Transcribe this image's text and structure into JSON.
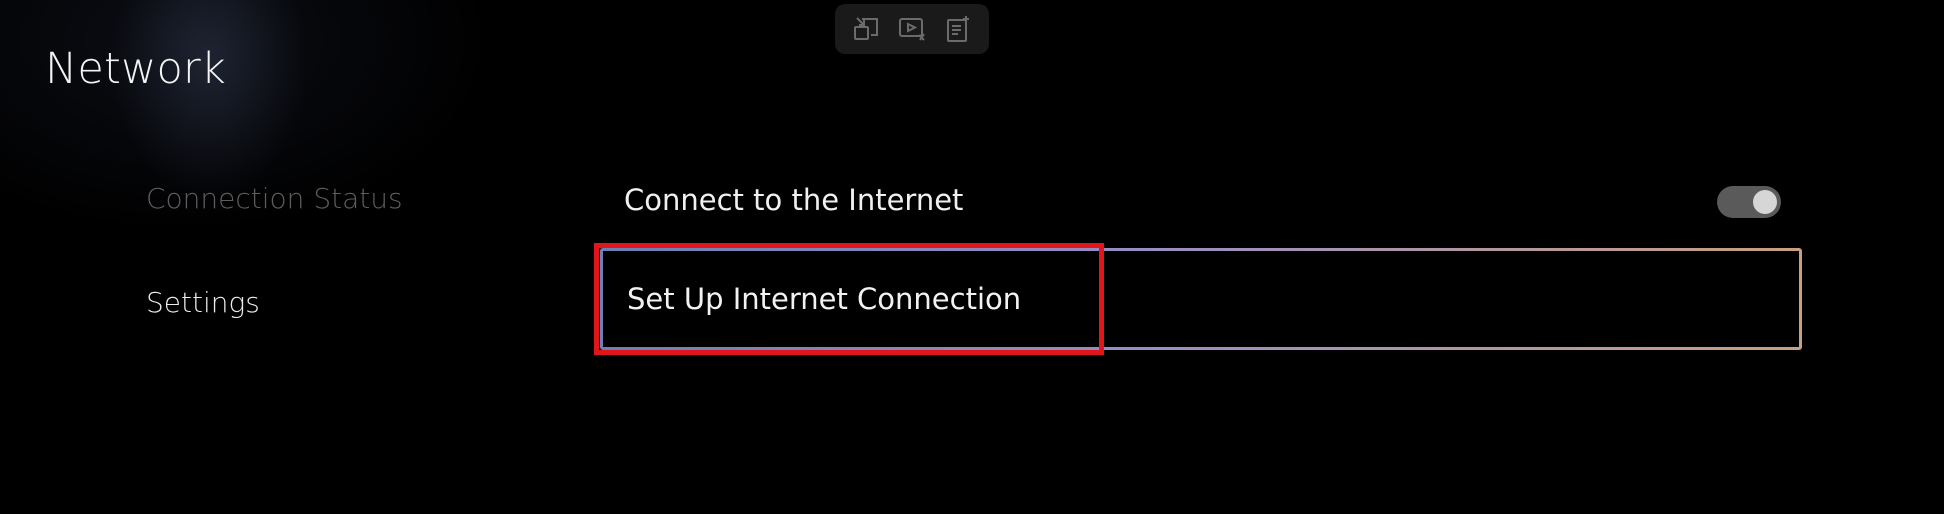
{
  "page": {
    "title": "Network"
  },
  "capture_toolbar": {
    "icons": [
      "picture-in-picture-icon",
      "video-capture-icon",
      "notes-add-icon"
    ]
  },
  "left_nav": {
    "items": [
      {
        "label": "Connection Status",
        "state": "dimmed"
      },
      {
        "label": "Settings",
        "state": "selected"
      }
    ]
  },
  "settings": {
    "connect_internet": {
      "label": "Connect to the Internet",
      "toggle_on": true
    },
    "setup_connection": {
      "label": "Set Up Internet Connection",
      "focused": true
    }
  },
  "colors": {
    "background": "#000000",
    "highlight": "#e0161b",
    "focus_border_start": "#6d7fb5",
    "focus_border_end": "#c8a080"
  }
}
